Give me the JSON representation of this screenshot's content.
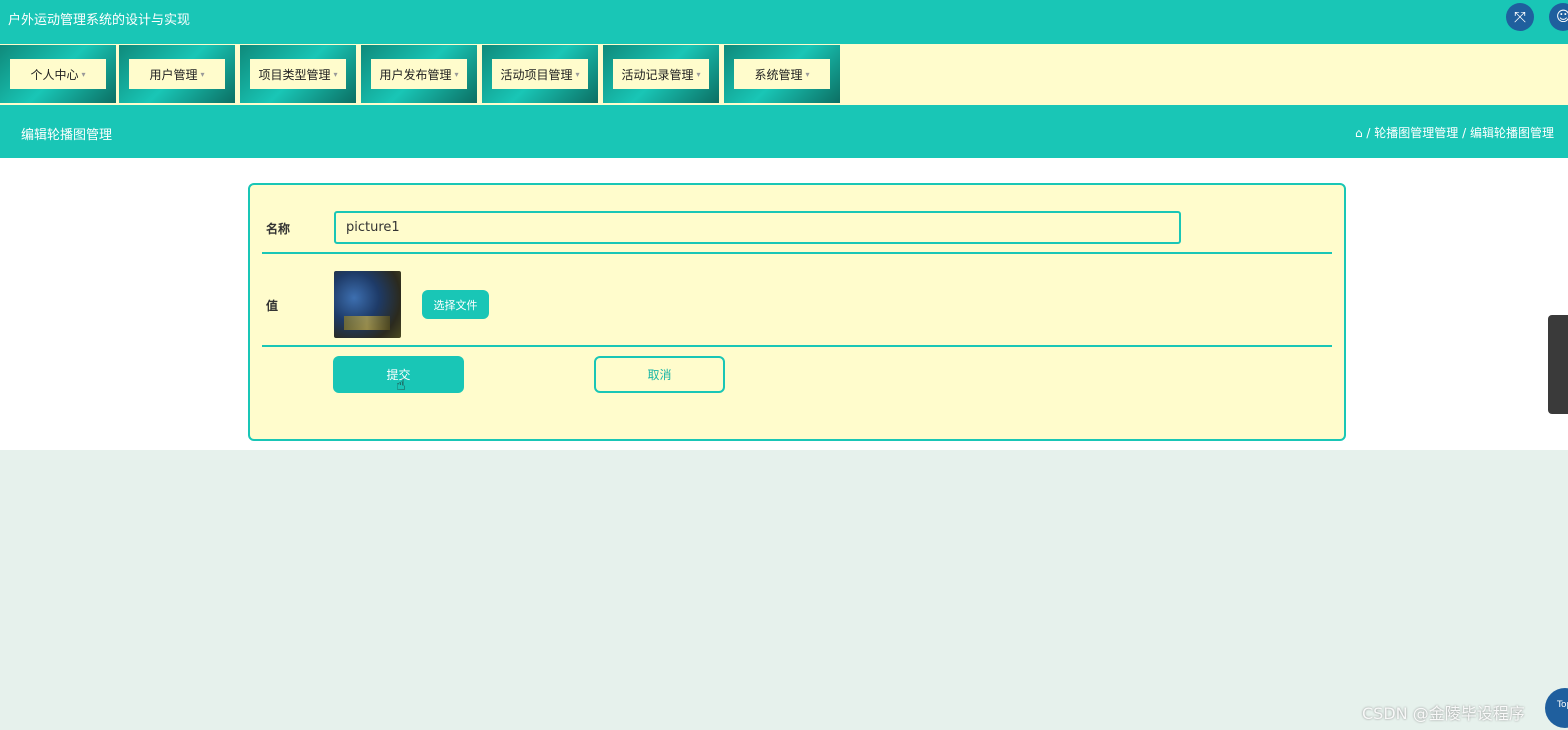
{
  "app": {
    "title": "户外运动管理系统的设计与实现"
  },
  "header_icons": {
    "fullscreen": "expand-arrows-icon",
    "user": "user-icon"
  },
  "menu": {
    "items": [
      {
        "label": "个人中心"
      },
      {
        "label": "用户管理"
      },
      {
        "label": "项目类型管理"
      },
      {
        "label": "用户发布管理"
      },
      {
        "label": "活动项目管理"
      },
      {
        "label": "活动记录管理"
      },
      {
        "label": "系统管理"
      }
    ],
    "caret": "▾"
  },
  "page": {
    "title": "编辑轮播图管理",
    "breadcrumb": "⌂ / 轮播图管理管理 / 编辑轮播图管理"
  },
  "form": {
    "name_label": "名称",
    "name_value": "picture1",
    "value_label": "值",
    "choose_file_label": "选择文件",
    "submit_label": "提交",
    "cancel_label": "取消"
  },
  "float": {
    "top_button_label": "Top"
  },
  "watermark": "CSDN @金陵毕设程序",
  "colors": {
    "primary": "#19c6b6",
    "menu_bg": "#fffccc",
    "page_bg": "#e6f1ec",
    "icon_button": "#1f5f9e"
  }
}
